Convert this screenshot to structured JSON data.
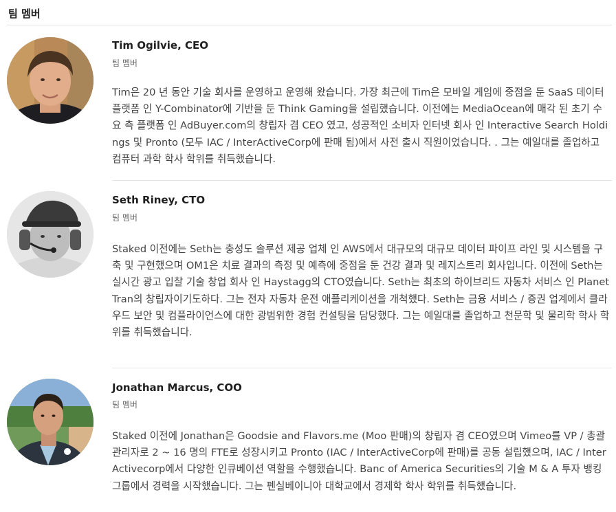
{
  "section": {
    "title": "팀 멤버"
  },
  "members": [
    {
      "name": "Tim Ogilvie, CEO",
      "role": "팀 멤버",
      "bio": "Tim은 20 년 동안 기술 회사를 운영하고 운영해 왔습니다. 가장 최근에 Tim은 모바일 게임에 중점을 둔 SaaS 데이터 플랫폼 인 Y-Combinator에 기반을 둔 Think Gaming을 설립했습니다. 이전에는 MediaOcean에 매각 된 초기 수요 측 플랫폼 인 AdBuyer.com의 창립자 겸 CEO 였고, 성공적인 소비자 인터넷 회사 인 Interactive Search Holdings 및 Pronto (모두 IAC / InterActiveCorp에 판매 됨)에서 사전 출시 직원이었습니다. . 그는 예일대를 졸업하고 컴퓨터 과학 학사 학위를 취득했습니다.",
      "photo": "avatar-tim-photo"
    },
    {
      "name": "Seth Riney, CTO",
      "role": "팀 멤버",
      "bio": "Staked 이전에는 Seth는 충성도 솔루션 제공 업체 인 AWS에서 대규모의 대규모 데이터 파이프 라인 및 시스템을 구축 및 구현했으며 OM1은 치료 결과의 측정 및 예측에 중점을 둔 건강 결과 및 레지스트리 회사입니다. 이전에 Seth는 실시간 광고 입찰 기술 창업 회사 인 Haystagg의 CTO였습니다. Seth는 최초의 하이브리드 자동차 서비스 인 PlanetTran의 창립자이기도하다. 그는 전자 자동차 운전 애플리케이션을 개척했다. Seth는 금융 서비스 / 증권 업계에서 클라우드 보안 및 컴플라이언스에 대한 광범위한 경험 컨설팅을 담당했다. 그는 예일대를 졸업하고 천문학 및 물리학 학사 학위를 취득했습니다.",
      "photo": "avatar-seth-photo"
    },
    {
      "name": "Jonathan Marcus, COO",
      "role": "팀 멤버",
      "bio": "Staked 이전에 Jonathan은 Goodsie and Flavors.me (Moo 판매)의 창립자 겸 CEO였으며 Vimeo를 VP / 총괄 관리자로 2 ~ 16 명의 FTE로 성장시키고 Pronto (IAC / InterActiveCorp에 판매)를 공동 설립했으며, IAC / InterActivecorp에서 다양한 인큐베이션 역할을 수행했습니다. Banc of America Securities의 기술 M & A 투자 뱅킹 그룹에서 경력을 시작했습니다. 그는 펜실베이니아 대학교에서 경제학 학사 학위를 취득했습니다.",
      "photo": "avatar-jonathan-photo"
    }
  ]
}
